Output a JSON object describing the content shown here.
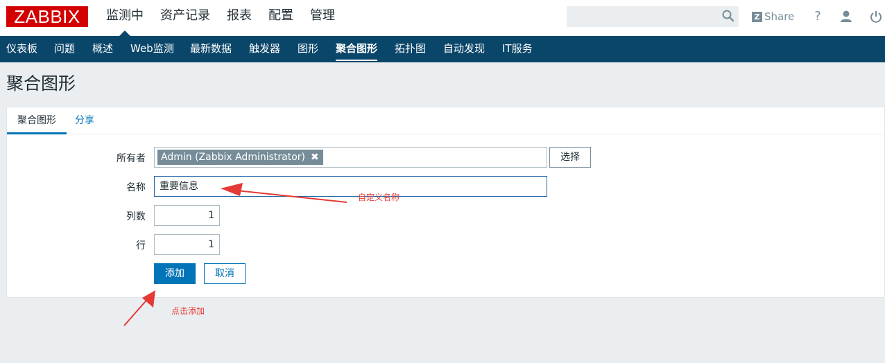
{
  "header": {
    "logo": "ZABBIX",
    "menu": [
      "监测中",
      "资产记录",
      "报表",
      "配置",
      "管理"
    ],
    "selected_menu": "监测中",
    "search": {
      "value": "",
      "placeholder": ""
    },
    "share_label": "Share",
    "help_label": "?"
  },
  "subnav": {
    "items": [
      "仪表板",
      "问题",
      "概述",
      "Web监测",
      "最新数据",
      "触发器",
      "图形",
      "聚合图形",
      "拓扑图",
      "自动发现",
      "IT服务"
    ],
    "selected": "聚合图形"
  },
  "page": {
    "title": "聚合图形"
  },
  "tabs": [
    "聚合图形",
    "分享"
  ],
  "form": {
    "owner": {
      "label": "所有者",
      "tag": "Admin (Zabbix Administrator)",
      "select_button": "选择"
    },
    "name": {
      "label": "名称",
      "value": "重要信息"
    },
    "columns": {
      "label": "列数",
      "value": "1"
    },
    "rows": {
      "label": "行",
      "value": "1"
    },
    "add_button": "添加",
    "cancel_button": "取消"
  },
  "annotations": {
    "name_note": "自定义名称",
    "add_note": "点击添加"
  },
  "colors": {
    "brand": "#d40000",
    "nav": "#0a466a",
    "primary": "#0275b8",
    "annotation": "#e53935"
  }
}
